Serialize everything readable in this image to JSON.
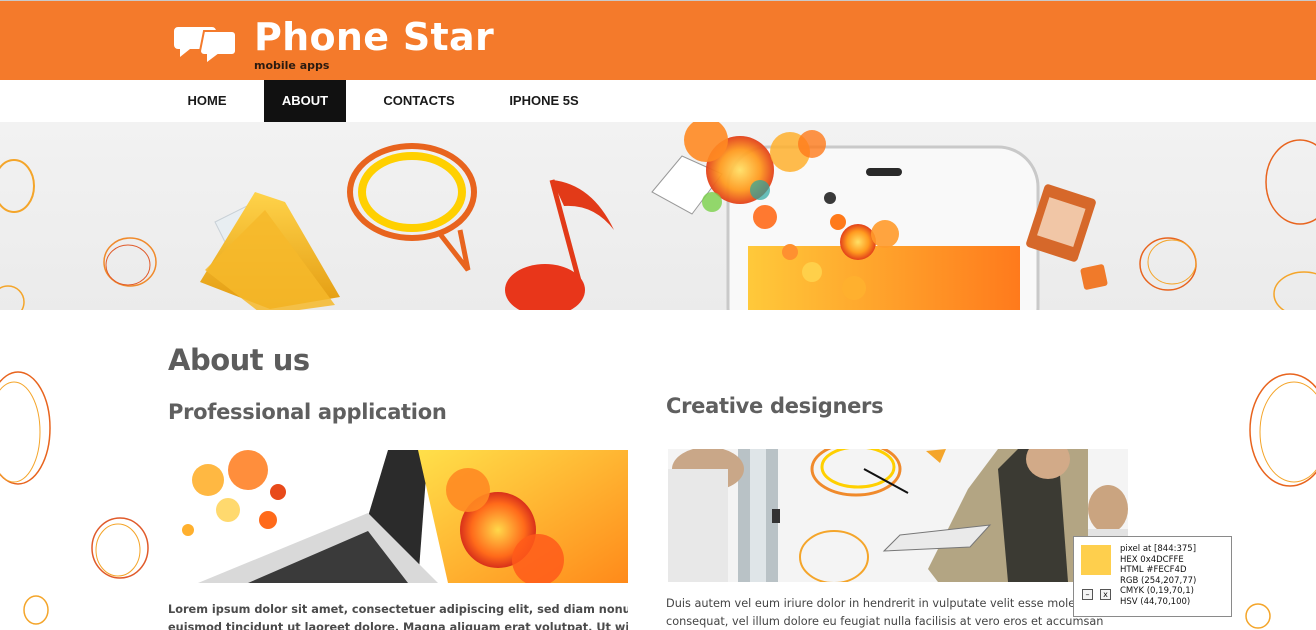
{
  "header": {
    "title": "Phone Star",
    "tagline": "mobile apps",
    "logo_icon": "speech-bubbles-icon"
  },
  "nav": {
    "items": [
      {
        "label": "HOME",
        "active": false
      },
      {
        "label": "ABOUT",
        "active": true
      },
      {
        "label": "CONTACTS",
        "active": false
      },
      {
        "label": "IPHONE 5S",
        "active": false
      }
    ]
  },
  "main": {
    "heading": "About us",
    "columns": [
      {
        "heading": "Professional application",
        "text_lines": [
          "Lorem ipsum dolor sit amet, consectetuer adipiscing elit, sed diam nonummy nibh",
          "euismod tincidunt ut laoreet dolore. Magna aliquam erat volutpat. Ut wisi enim ad"
        ]
      },
      {
        "heading": "Creative designers",
        "text_lines": [
          "Duis autem vel eum iriure dolor in hendrerit in vulputate velit esse molestie",
          "consequat, vel illum dolore eu feugiat nulla facilisis at vero eros et accumsan"
        ]
      }
    ]
  },
  "color_picker": {
    "lines": [
      "pixel at [844:375]",
      "HEX 0x4DCFFE",
      "HTML #FECF4D",
      "RGB (254,207,77)",
      "CMYK (0,19,70,1)",
      "HSV (44,70,100)"
    ],
    "swatch_color": "#FECF4D",
    "minimize_label": "–",
    "close_label": "x"
  },
  "colors": {
    "brand_orange": "#f47a2b",
    "nav_active": "#111111"
  }
}
